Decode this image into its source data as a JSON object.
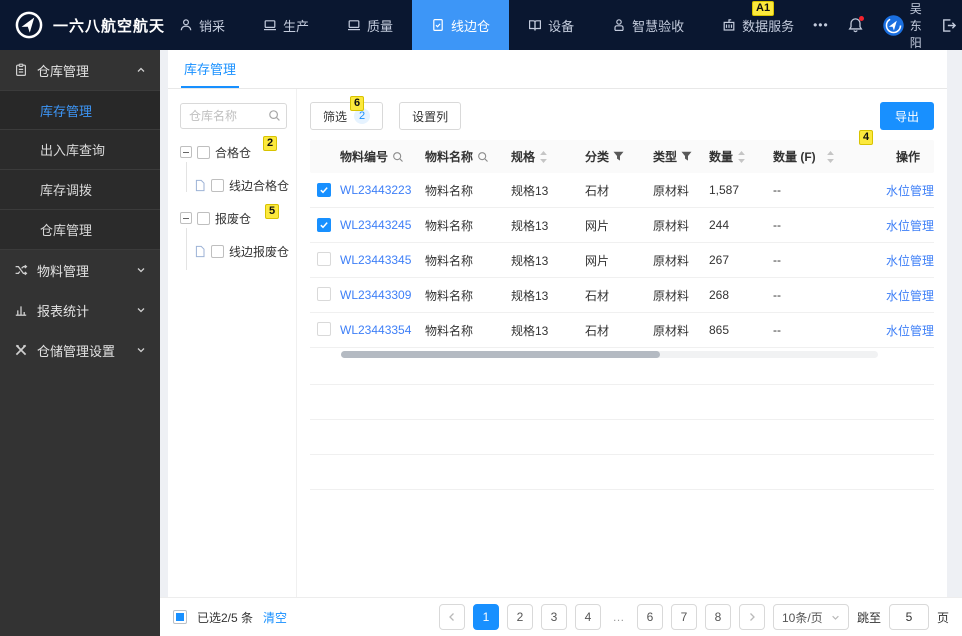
{
  "colors": {
    "accent": "#1890ff",
    "nav_active": "#3d96f7",
    "link": "#3e7ff7",
    "annotation_bg": "#fce93d",
    "sidebar_bg": "#333333",
    "navbar_bg": "#0a1730"
  },
  "navbar": {
    "brand": "一六八航空航天",
    "items": [
      {
        "label": "销采"
      },
      {
        "label": "生产"
      },
      {
        "label": "质量"
      },
      {
        "label": "线边仓"
      },
      {
        "label": "设备"
      },
      {
        "label": "智慧验收"
      },
      {
        "label": "数据服务"
      }
    ],
    "more": "•••",
    "username": "吴东阳",
    "logout_label": "退出"
  },
  "annotations": {
    "bell": "A1",
    "tree_top": "2",
    "tree_bottom": "5",
    "filter": "6",
    "table": "4"
  },
  "sidebar": {
    "group_label": "仓库管理",
    "sub_items": [
      {
        "label": "库存管理"
      },
      {
        "label": "出入库查询"
      },
      {
        "label": "库存调拨"
      },
      {
        "label": "仓库管理"
      }
    ],
    "other_items": [
      {
        "label": "物料管理"
      },
      {
        "label": "报表统计"
      },
      {
        "label": "仓储管理设置"
      }
    ]
  },
  "tabs": {
    "active": "库存管理"
  },
  "tree": {
    "search_placeholder": "仓库名称",
    "nodes": [
      {
        "label": "合格仓"
      },
      {
        "label": "线边合格仓"
      },
      {
        "label": "报废仓"
      },
      {
        "label": "线边报废仓"
      }
    ]
  },
  "toolbar": {
    "filter_label": "筛选",
    "filter_count": "2",
    "columns_label": "设置列",
    "export_label": "导出"
  },
  "table": {
    "headers": {
      "code": "物料编号",
      "name": "物料名称",
      "spec": "规格",
      "category": "分类",
      "type": "类型",
      "qty": "数量",
      "qty_f": "数量 (F)",
      "action": "操作"
    },
    "rows": [
      {
        "checked": true,
        "code": "WL23443223",
        "name": "物料名称",
        "spec": "规格13",
        "category": "石材",
        "type": "原材料",
        "qty": "1,587",
        "qty_f": "--",
        "action": "水位管理"
      },
      {
        "checked": true,
        "code": "WL23443245",
        "name": "物料名称",
        "spec": "规格13",
        "category": "网片",
        "type": "原材料",
        "qty": "244",
        "qty_f": "--",
        "action": "水位管理"
      },
      {
        "checked": false,
        "code": "WL23443345",
        "name": "物料名称",
        "spec": "规格13",
        "category": "网片",
        "type": "原材料",
        "qty": "267",
        "qty_f": "--",
        "action": "水位管理"
      },
      {
        "checked": false,
        "code": "WL23443309",
        "name": "物料名称",
        "spec": "规格13",
        "category": "石材",
        "type": "原材料",
        "qty": "268",
        "qty_f": "--",
        "action": "水位管理"
      },
      {
        "checked": false,
        "code": "WL23443354",
        "name": "物料名称",
        "spec": "规格13",
        "category": "石材",
        "type": "原材料",
        "qty": "865",
        "qty_f": "--",
        "action": "水位管理"
      }
    ]
  },
  "footer": {
    "selected_text": "已选2/5 条",
    "clear_label": "清空",
    "pagination": {
      "pages": [
        "1",
        "2",
        "3",
        "4",
        "…",
        "6",
        "7",
        "8"
      ],
      "active_page": "1",
      "page_size": "10条/页",
      "jump_label": "跳至",
      "jump_value": "5",
      "page_suffix": "页"
    }
  }
}
